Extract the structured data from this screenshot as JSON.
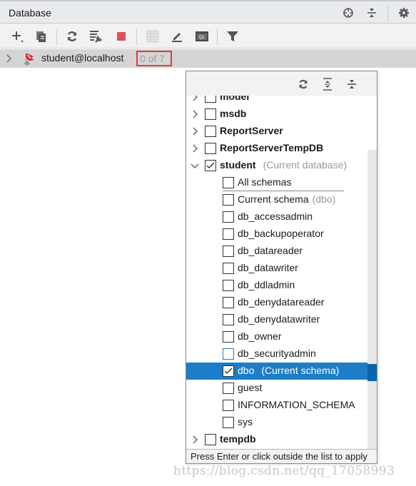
{
  "header": {
    "title": "Database",
    "icons": [
      "locate-icon",
      "collapse-all-icon",
      "gear-icon"
    ]
  },
  "toolbar": {
    "buttons": [
      {
        "name": "add-datasource-button",
        "icon": "plus-icon"
      },
      {
        "name": "duplicate-button",
        "icon": "copy-icon"
      },
      {
        "name": "refresh-button",
        "icon": "refresh-icon"
      },
      {
        "name": "datasource-properties-button",
        "icon": "db-wrench-icon"
      },
      {
        "name": "stop-button",
        "icon": "stop-icon"
      },
      {
        "name": "table-view-button",
        "icon": "table-icon"
      },
      {
        "name": "edit-button",
        "icon": "pencil-icon"
      },
      {
        "name": "sql-console-button",
        "icon": "sql-icon"
      },
      {
        "name": "filter-button",
        "icon": "filter-icon"
      }
    ],
    "colors": {
      "stop": "#e0505a",
      "icon": "#555555"
    }
  },
  "tree": {
    "datasource_label": "student@localhost",
    "schema_count": "0 of 7",
    "highlight_color": "#e8383d"
  },
  "popup": {
    "footer_text": "Press Enter or click outside the list to apply",
    "items": [
      {
        "label": "model",
        "level": 0,
        "expand": "collapsed",
        "checked": false,
        "bold": true,
        "note": ""
      },
      {
        "label": "msdb",
        "level": 0,
        "expand": "collapsed",
        "checked": false,
        "bold": true,
        "note": ""
      },
      {
        "label": "ReportServer",
        "level": 0,
        "expand": "collapsed",
        "checked": false,
        "bold": true,
        "note": ""
      },
      {
        "label": "ReportServerTempDB",
        "level": 0,
        "expand": "collapsed",
        "checked": false,
        "bold": true,
        "note": ""
      },
      {
        "label": "student",
        "level": 0,
        "expand": "expanded",
        "checked": true,
        "bold": true,
        "note": "(Current database)"
      },
      {
        "label": "All schemas",
        "level": 1,
        "checked": false,
        "bold": false,
        "note": ""
      },
      {
        "label": "Current schema",
        "level": 1,
        "checked": false,
        "bold": false,
        "note": "(dbo)"
      },
      {
        "label": "db_accessadmin",
        "level": 1,
        "checked": false,
        "bold": false,
        "note": ""
      },
      {
        "label": "db_backupoperator",
        "level": 1,
        "checked": false,
        "bold": false,
        "note": ""
      },
      {
        "label": "db_datareader",
        "level": 1,
        "checked": false,
        "bold": false,
        "note": ""
      },
      {
        "label": "db_datawriter",
        "level": 1,
        "checked": false,
        "bold": false,
        "note": ""
      },
      {
        "label": "db_ddladmin",
        "level": 1,
        "checked": false,
        "bold": false,
        "note": ""
      },
      {
        "label": "db_denydatareader",
        "level": 1,
        "checked": false,
        "bold": false,
        "note": ""
      },
      {
        "label": "db_denydatawriter",
        "level": 1,
        "checked": false,
        "bold": false,
        "note": ""
      },
      {
        "label": "db_owner",
        "level": 1,
        "checked": false,
        "bold": false,
        "note": ""
      },
      {
        "label": "db_securityadmin",
        "level": 1,
        "checked": false,
        "bold": false,
        "note": "",
        "focused": true
      },
      {
        "label": "dbo",
        "level": 1,
        "checked": true,
        "bold": false,
        "note": "(Current schema)",
        "selected": true
      },
      {
        "label": "guest",
        "level": 1,
        "checked": false,
        "bold": false,
        "note": ""
      },
      {
        "label": "INFORMATION_SCHEMA",
        "level": 1,
        "checked": false,
        "bold": false,
        "note": ""
      },
      {
        "label": "sys",
        "level": 1,
        "checked": false,
        "bold": false,
        "note": ""
      },
      {
        "label": "tempdb",
        "level": 0,
        "expand": "collapsed",
        "checked": false,
        "bold": true,
        "note": ""
      }
    ],
    "selected_color": "#1c7dc8"
  },
  "watermark": "https://blog.csdn.net/qq_17058993"
}
